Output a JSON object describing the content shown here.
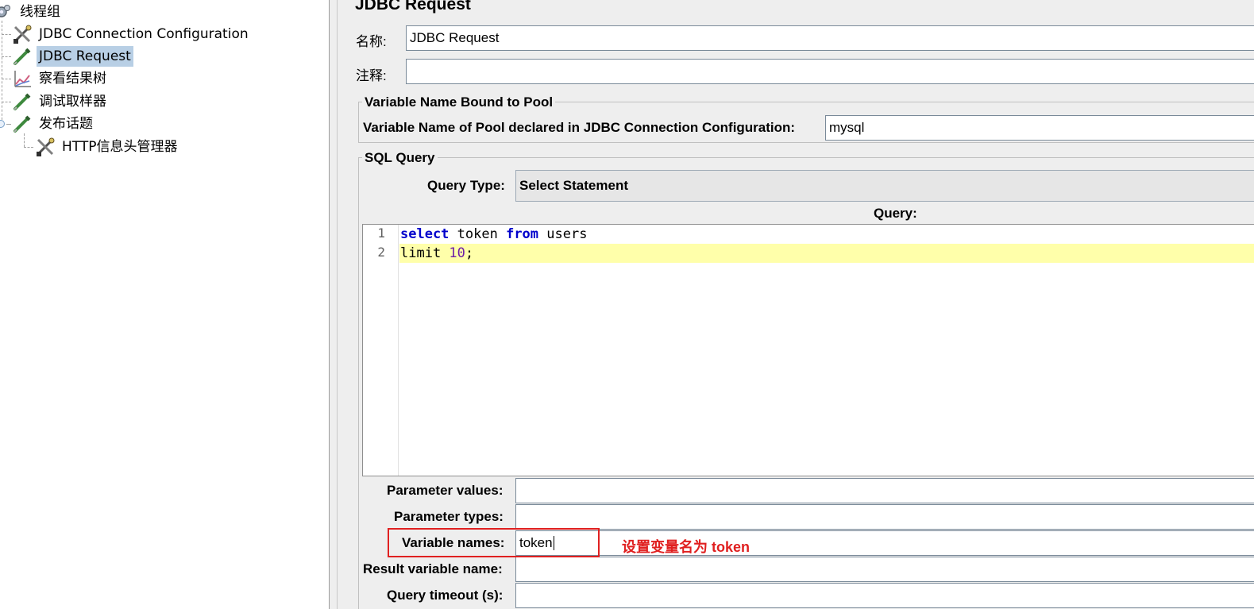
{
  "tree": {
    "items": [
      {
        "label": "线程组",
        "icon": "gears-icon"
      },
      {
        "label": "JDBC Connection Configuration",
        "icon": "wrench-screwdriver-icon"
      },
      {
        "label": "JDBC Request",
        "icon": "dropper-icon",
        "selected": true
      },
      {
        "label": "察看结果树",
        "icon": "graph-icon"
      },
      {
        "label": "调试取样器",
        "icon": "dropper-icon"
      },
      {
        "label": "发布话题",
        "icon": "dropper-icon"
      },
      {
        "label": "HTTP信息头管理器",
        "icon": "wrench-screwdriver-icon"
      }
    ]
  },
  "panel": {
    "title": "JDBC Request",
    "name_label": "名称:",
    "name_value": "JDBC Request",
    "comment_label": "注释:",
    "comment_value": "",
    "pool_group": {
      "title": "Variable Name Bound to Pool",
      "label": "Variable Name of Pool declared in JDBC Connection Configuration:",
      "value": "mysql"
    },
    "sql_group": {
      "title": "SQL Query",
      "query_type_label": "Query Type:",
      "query_type_value": "Select Statement",
      "query_label": "Query:",
      "code": {
        "line_numbers": [
          "1",
          "2"
        ],
        "line1": {
          "kw1": "select",
          "t1": " token ",
          "kw2": "from",
          "t2": " users"
        },
        "line2": {
          "t1": "limit ",
          "num": "10",
          "t2": ";"
        }
      },
      "param_values_label": "Parameter values:",
      "param_values_value": "",
      "param_types_label": "Parameter types:",
      "param_types_value": "",
      "variable_names_label": "Variable names:",
      "variable_names_value": "token",
      "result_var_label": "Result variable name:",
      "result_var_value": "",
      "timeout_label": "Query timeout (s):",
      "timeout_value": ""
    }
  },
  "annotation": {
    "text": "设置变量名为 token",
    "color": "#e02020"
  },
  "colors": {
    "selected_bg": "#b8cfe5",
    "current_line_bg": "#ffffaa",
    "keyword": "#0000cc",
    "number": "#6e1ea8",
    "panel_bg": "#eeeeee"
  }
}
